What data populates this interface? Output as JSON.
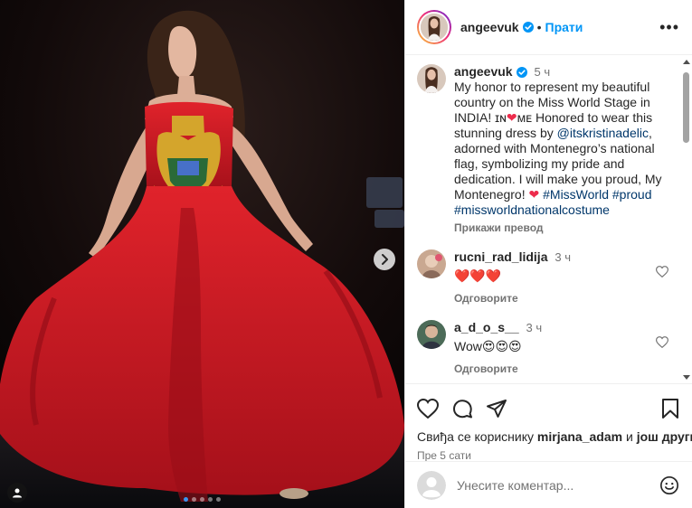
{
  "post": {
    "author": "angeevuk",
    "follow_label": "Прати",
    "more_label": "•••",
    "caption": {
      "username": "angeevuk",
      "time": "5 ч",
      "text_1": "My honor to represent my beautiful country on the Miss World Stage in INDIA! ",
      "in_small": "ɪɴ",
      "me_small": "ᴍᴇ",
      "text_2": " Honored to wear this stunning dress by ",
      "mention": "@itskristinadelic",
      "text_3": ", adorned with Montenegro’s national flag, symbolizing my pride and dedication. I will make you proud, My Montenegro! ",
      "hashtag_1": "#MissWorld",
      "hashtag_2": "#proud",
      "hashtag_3": "#missworldnationalcostume",
      "heart": "❤️",
      "translate_label": "Прикажи превод"
    },
    "comments": [
      {
        "username": "rucni_rad_lidija",
        "time": "3 ч",
        "text": "❤️❤️❤️",
        "reply_label": "Одговорите"
      },
      {
        "username": "a_d_o_s__",
        "time": "3 ч",
        "text": "Wow😍😍😍",
        "reply_label": "Одговорите"
      }
    ],
    "likes": {
      "prefix": "Свиђа се кориснику ",
      "user": "mirjana_adam",
      "middle": " и ",
      "others": "још други"
    },
    "posted_time": "Пре 5 сати",
    "comment_placeholder": "Унесите коментар...",
    "carousel": {
      "slide_count": 5,
      "active_index": 0
    }
  },
  "icons": {
    "verified": "verified-badge-icon",
    "like": "heart-icon",
    "comment": "comment-icon",
    "share": "share-icon",
    "save": "bookmark-icon",
    "emoji": "emoji-icon",
    "next": "chevron-right-icon",
    "tag": "user-tag-icon"
  },
  "colors": {
    "accent": "#0095f6",
    "link": "#00376b",
    "heart": "#ed2c4c",
    "muted": "#737373",
    "dress": "#d41a22"
  }
}
